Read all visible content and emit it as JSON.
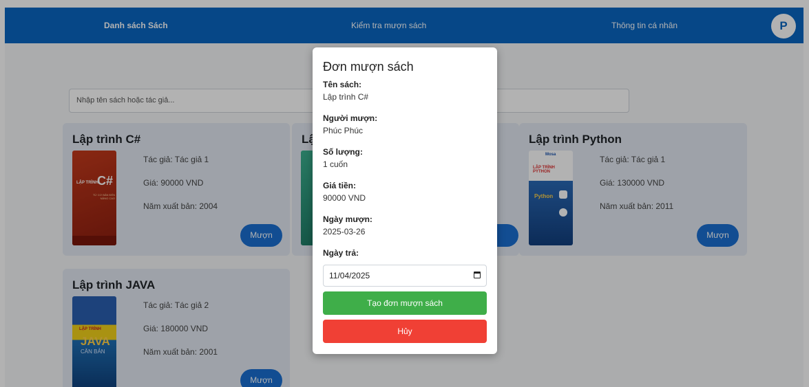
{
  "nav": {
    "books": "Danh sách Sách",
    "check": "Kiểm tra mượn sách",
    "profile": "Thông tin cá nhân",
    "avatar_letter": "P"
  },
  "search": {
    "placeholder": "Nhập tên sách hoặc tác giả..."
  },
  "books": [
    {
      "title": "Lập trình C#",
      "author": "Tác giả: Tác giả 1",
      "price": "Giá: 90000 VND",
      "year": "Năm xuất bản: 2004",
      "borrow": "Mượn",
      "cover": {
        "top_text": "LẬP TRÌNH",
        "big": "C#",
        "sub": "TỪ CƠ BẢN ĐẾN NÂNG CAO"
      }
    },
    {
      "title": "Lậ"
    },
    {
      "title": "Lập trình Python",
      "author": "Tác giả: Tác giả 1",
      "price": "Giá: 130000 VND",
      "year": "Năm xuất bản: 2011",
      "borrow": "Mượn",
      "cover": {
        "brand": "Mosa",
        "top_text": "LẬP TRÌNH PYTHON",
        "big": "Python"
      }
    },
    {
      "title": "Lập trình JAVA",
      "author": "Tác giả: Tác giả 2",
      "price": "Giá: 180000 VND",
      "year": "Năm xuất bản: 2001",
      "borrow": "Mượn",
      "cover": {
        "top_text": "LẬP TRÌNH",
        "big": "JAVA",
        "sub": "CĂN BẢN"
      }
    }
  ],
  "modal": {
    "title": "Đơn mượn sách",
    "book_label": "Tên sách:",
    "book_value": "Lập trình C#",
    "borrower_label": "Người mượn:",
    "borrower_value": "Phúc Phúc",
    "qty_label": "Số lượng:",
    "qty_value": "1 cuốn",
    "price_label": "Giá tiền:",
    "price_value": "90000 VND",
    "borrow_date_label": "Ngày mượn:",
    "borrow_date_value": "2025-03-26",
    "return_label": "Ngày trả:",
    "return_value": "11/04/2025",
    "create_button": "Tạo đơn mượn sách",
    "cancel_button": "Hủy"
  },
  "colors": {
    "nav": "#0a66c2",
    "accent": "#1a6fd1",
    "success": "#3fae49",
    "danger": "#f04035"
  }
}
